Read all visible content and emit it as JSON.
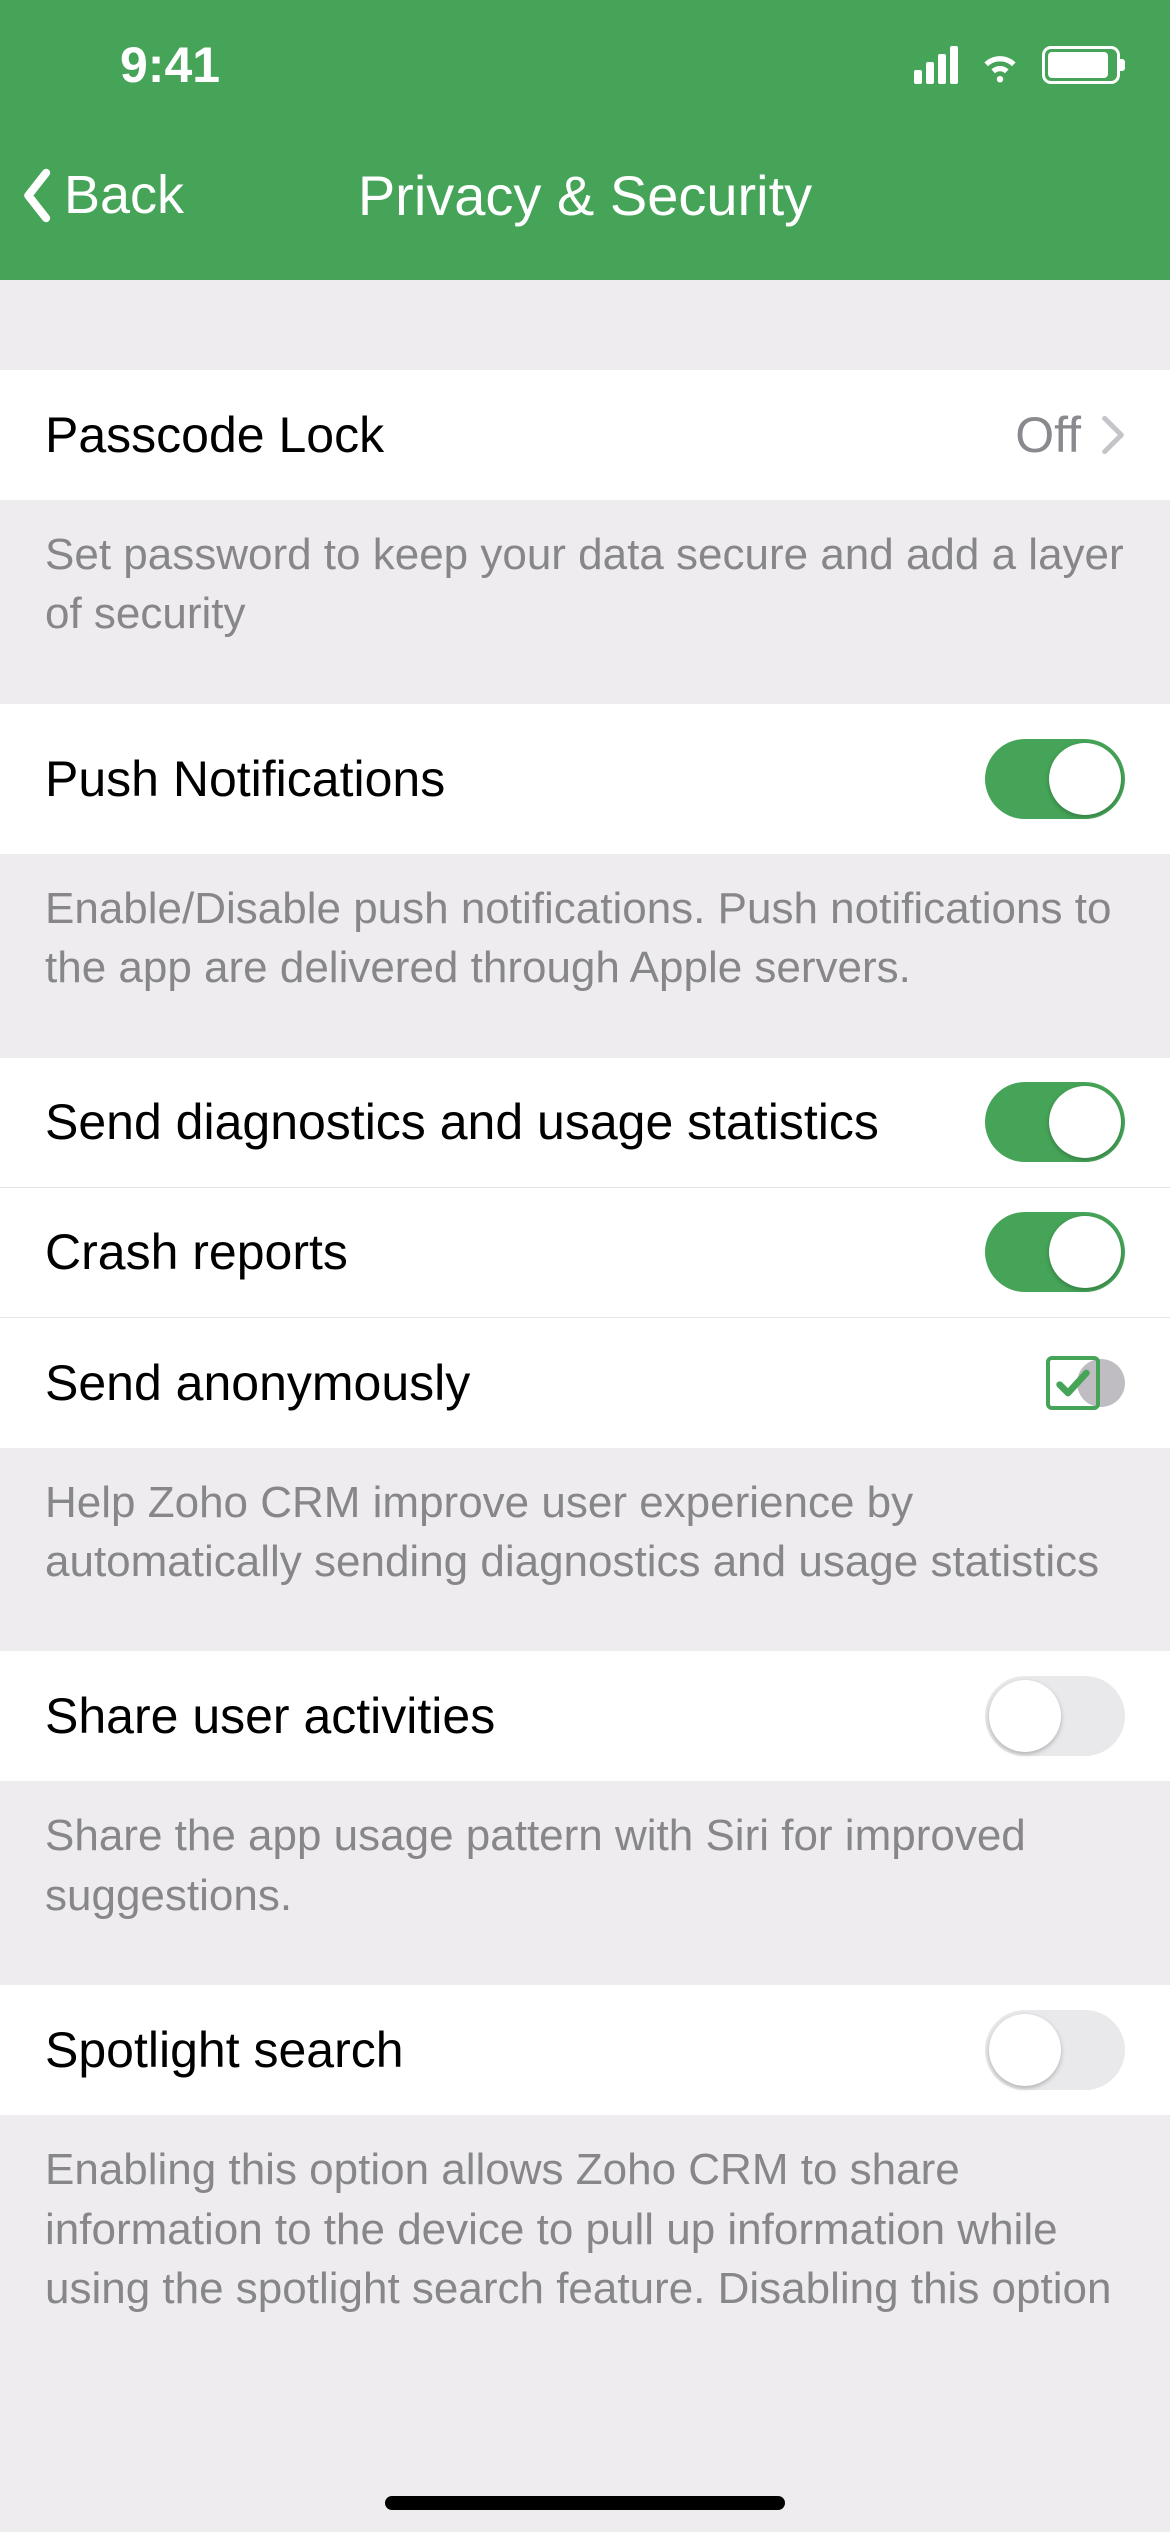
{
  "status": {
    "time": "9:41"
  },
  "nav": {
    "back_label": "Back",
    "title": "Privacy & Security"
  },
  "sections": {
    "passcode": {
      "label": "Passcode Lock",
      "value": "Off",
      "footer": "Set password to keep your data secure and add a layer of security"
    },
    "push": {
      "label": "Push Notifications",
      "on": true,
      "footer": "Enable/Disable push notifications. Push notifications to the app are delivered through Apple servers."
    },
    "diagnostics": {
      "send_label": "Send diagnostics and usage statistics",
      "send_on": true,
      "crash_label": "Crash reports",
      "crash_on": true,
      "anonymous_label": "Send anonymously",
      "anonymous_checked": true,
      "footer": "Help Zoho CRM improve user experience by automatically sending diagnostics and usage statistics"
    },
    "share_activities": {
      "label": "Share user activities",
      "on": false,
      "footer": "Share the app usage pattern with Siri for improved suggestions."
    },
    "spotlight": {
      "label": "Spotlight search",
      "on": false,
      "footer": "Enabling this option allows Zoho CRM to share information to the device to pull up information while using the spotlight search feature. Disabling this option"
    }
  }
}
